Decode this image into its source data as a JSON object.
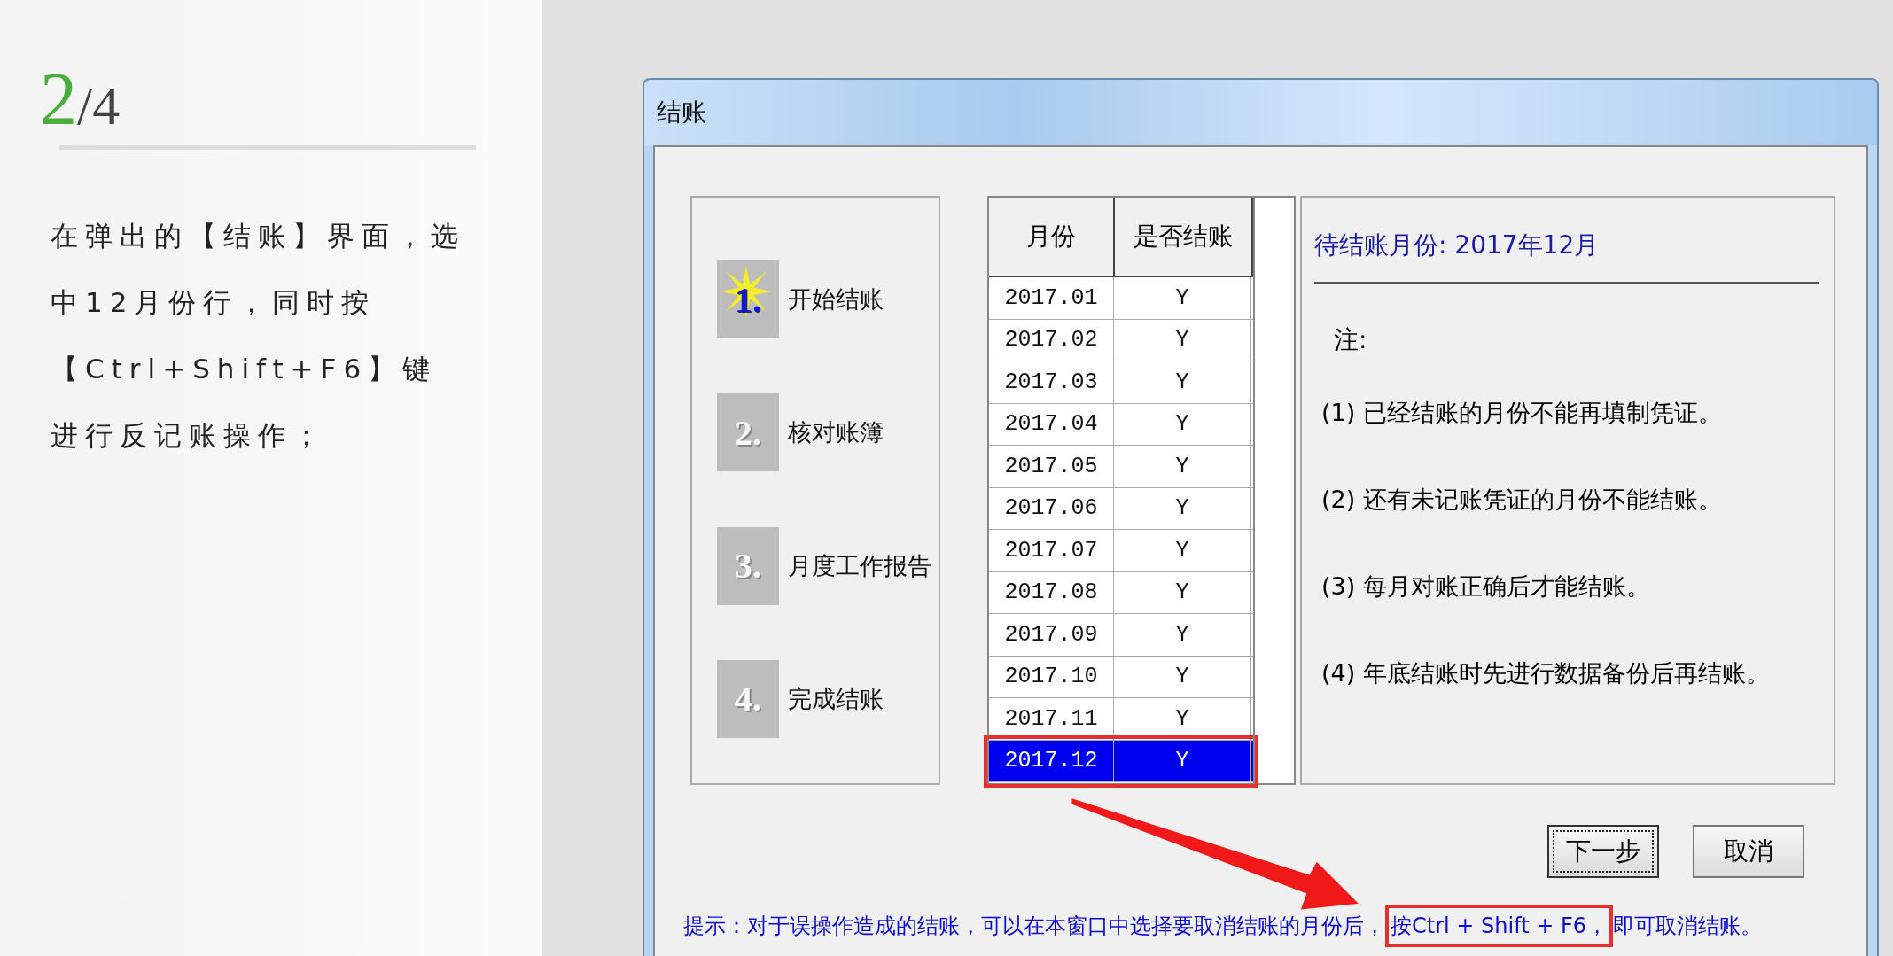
{
  "tutorial": {
    "step_current": "2",
    "step_total": "/4",
    "instruction": "在弹出的【结账】界面，选中12月份行，同时按【Ctrl+Shift+F6】键进行反记账操作；"
  },
  "window": {
    "title": "结账"
  },
  "steps": [
    {
      "number": "1.",
      "label": "开始结账",
      "active": true
    },
    {
      "number": "2.",
      "label": "核对账簿",
      "active": false
    },
    {
      "number": "3.",
      "label": "月度工作报告",
      "active": false
    },
    {
      "number": "4.",
      "label": "完成结账",
      "active": false
    }
  ],
  "table": {
    "columns": [
      "月份",
      "是否结账"
    ],
    "rows": [
      {
        "month": "2017.01",
        "closed": "Y",
        "selected": false
      },
      {
        "month": "2017.02",
        "closed": "Y",
        "selected": false
      },
      {
        "month": "2017.03",
        "closed": "Y",
        "selected": false
      },
      {
        "month": "2017.04",
        "closed": "Y",
        "selected": false
      },
      {
        "month": "2017.05",
        "closed": "Y",
        "selected": false
      },
      {
        "month": "2017.06",
        "closed": "Y",
        "selected": false
      },
      {
        "month": "2017.07",
        "closed": "Y",
        "selected": false
      },
      {
        "month": "2017.08",
        "closed": "Y",
        "selected": false
      },
      {
        "month": "2017.09",
        "closed": "Y",
        "selected": false
      },
      {
        "month": "2017.10",
        "closed": "Y",
        "selected": false
      },
      {
        "month": "2017.11",
        "closed": "Y",
        "selected": false
      },
      {
        "month": "2017.12",
        "closed": "Y",
        "selected": true
      }
    ]
  },
  "info": {
    "heading": "待结账月份: 2017年12月",
    "note_label": "注:",
    "notes": [
      "(1) 已经结账的月份不能再填制凭证。",
      "(2) 还有未记账凭证的月份不能结账。",
      "(3) 每月对账正确后才能结账。",
      "(4) 年底结账时先进行数据备份后再结账。"
    ]
  },
  "buttons": [
    {
      "label": "下一步",
      "focused": true
    },
    {
      "label": "取消",
      "focused": false
    }
  ],
  "hint": {
    "text_before": "提示：对于误操作造成的结账，可以在本窗口中选择要取消结账的月份后，",
    "highlighted": "按Ctrl + Shift + F6，",
    "text_after": "即可取消结账。"
  }
}
